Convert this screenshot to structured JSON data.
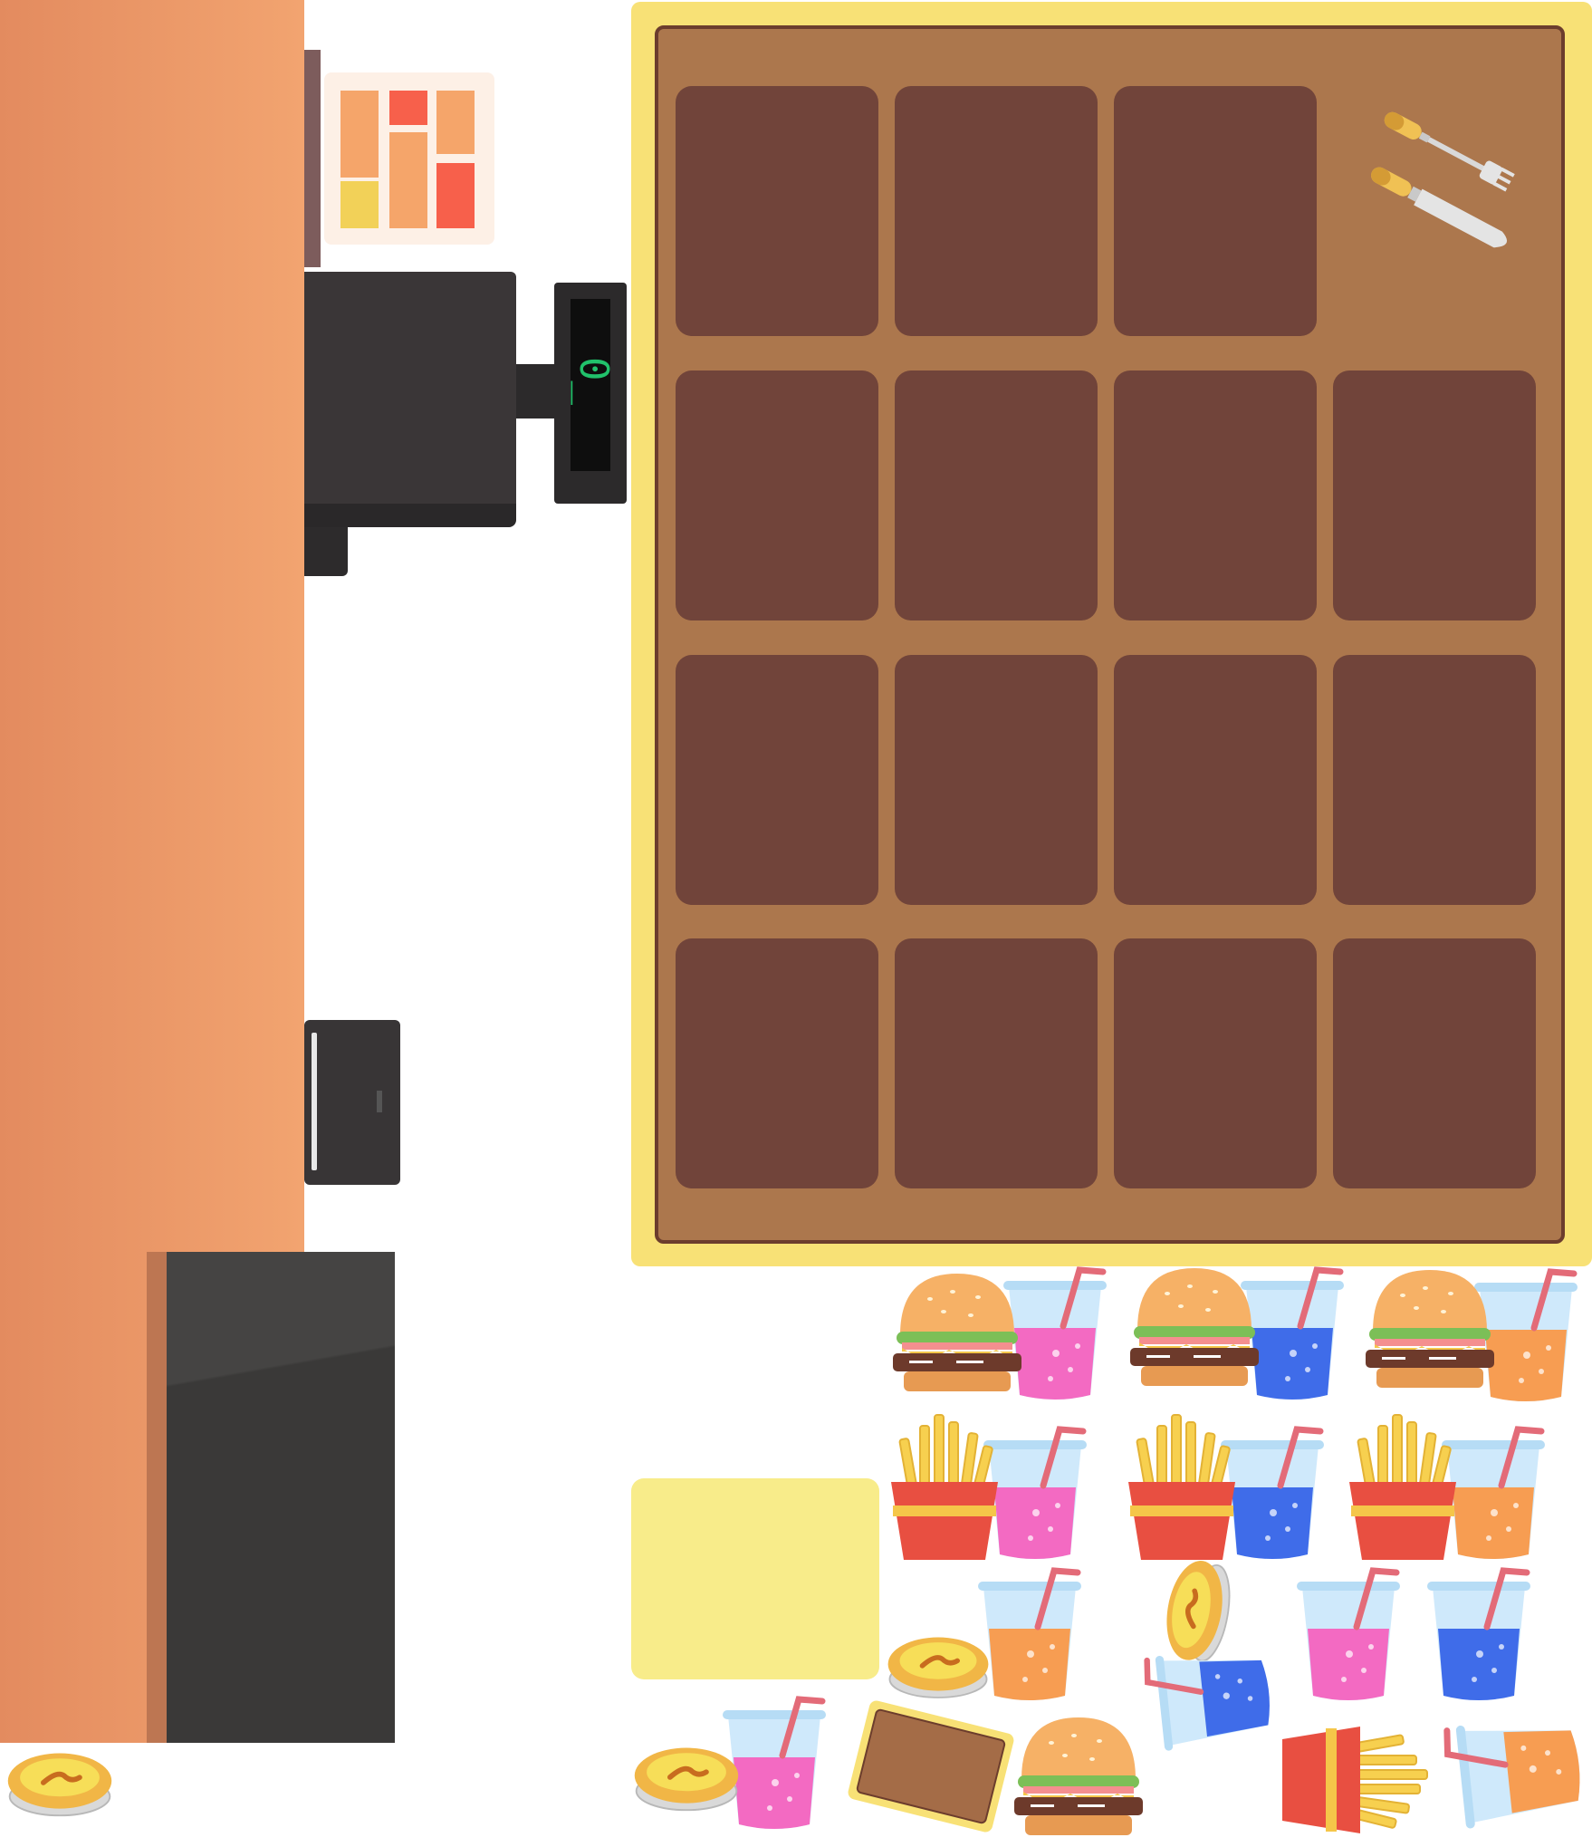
{
  "register": {
    "display_value": "0_"
  },
  "colors": {
    "counter": "#f2a470",
    "board_frame": "#f8e176",
    "board": "#ac774d",
    "slot": "#71443a",
    "plate": "#f8ec8a",
    "drink_pink": "#f36ac2",
    "drink_blue": "#3f6ce9",
    "drink_orange": "#f79d52"
  },
  "board": {
    "rows": [
      [
        "empty",
        "empty",
        "empty",
        "utensils"
      ],
      [
        "empty",
        "empty",
        "empty",
        "empty"
      ],
      [
        "empty",
        "empty",
        "empty",
        "empty"
      ],
      [
        "empty",
        "empty",
        "empty",
        "empty"
      ]
    ]
  },
  "menu_items": [
    "burger-pink-drink-combo",
    "burger-blue-drink-combo",
    "burger-orange-drink-combo",
    "fries-pink-drink-combo",
    "fries-blue-drink-combo",
    "fries-orange-drink-combo",
    "orange-drink",
    "egg-tart",
    "tipped-egg-tart",
    "tipped-blue-drink",
    "pink-drink",
    "blue-drink",
    "pink-drink-small",
    "egg-tart-small",
    "tray",
    "burger",
    "tipped-fries",
    "tipped-orange-drink",
    "egg-tart-on-counter"
  ]
}
